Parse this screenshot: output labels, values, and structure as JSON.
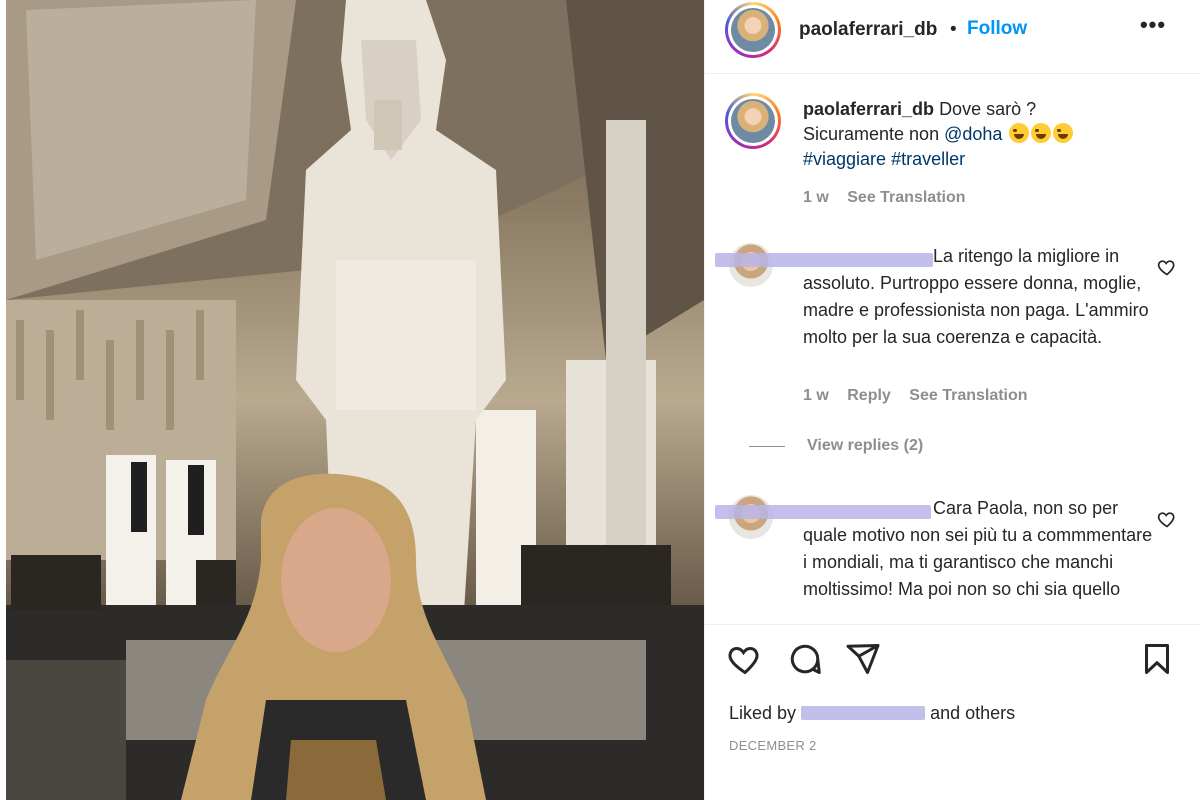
{
  "post": {
    "username": "paolaferrari_db",
    "follow_label": "Follow",
    "separator": "•",
    "more_label": "•••"
  },
  "caption": {
    "username": "paolaferrari_db",
    "text_1": "Dove sarò ?",
    "text_2": "Sicuramente non",
    "mention": "@doha",
    "hashtag_1": "#viaggiare",
    "hashtag_2": "#traveller",
    "time": "1 w",
    "see_translation": "See Translation"
  },
  "comments": [
    {
      "text": "La ritengo la migliore in assoluto. Purtroppo essere donna, moglie, madre e professionista non paga. L'ammiro molto per la sua coerenza e capacità.",
      "time": "1 w",
      "reply": "Reply",
      "see_translation": "See Translation",
      "view_replies": "View replies (2)"
    },
    {
      "text": "Cara Paola, non so per quale motivo non sei più tu a commmentare i mondiali, ma ti garantisco che manchi moltissimo! Ma poi non so chi sia quello"
    }
  ],
  "footer": {
    "liked_prefix": "Liked by",
    "liked_suffix": "and others",
    "date": "DECEMBER 2"
  },
  "icons": [
    "heart-icon",
    "comment-icon",
    "share-icon",
    "bookmark-icon",
    "more-icon"
  ]
}
